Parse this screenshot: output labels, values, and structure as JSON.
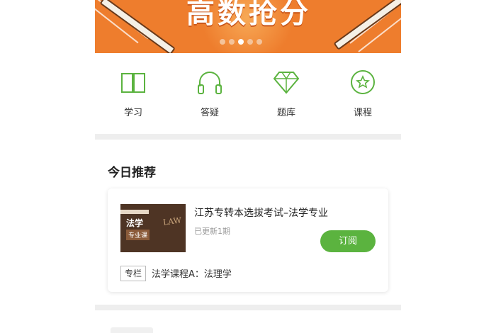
{
  "banner": {
    "title": "高数抢分",
    "dots_total": 5,
    "dots_active_index": 2
  },
  "nav": {
    "items": [
      {
        "label": "学习",
        "icon": "book-icon"
      },
      {
        "label": "答疑",
        "icon": "headphones-icon"
      },
      {
        "label": "题库",
        "icon": "diamond-icon"
      },
      {
        "label": "课程",
        "icon": "star-circle-icon"
      }
    ]
  },
  "recommend": {
    "section_title": "今日推荐",
    "course": {
      "title": "江苏专转本选拔考试–法学专业",
      "update": "已更新1期",
      "subscribe_label": "订阅",
      "thumb_title": "法学",
      "thumb_sub": "专业课",
      "thumb_watermark": "LAW",
      "tag": "专栏",
      "tag_text": "法学课程A：法理学"
    }
  },
  "colors": {
    "accent_green": "#5bb33f",
    "banner_orange": "#ee7d2d"
  }
}
